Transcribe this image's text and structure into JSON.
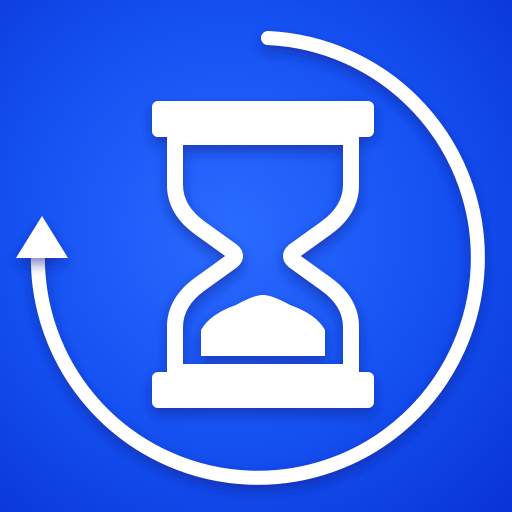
{
  "icon": {
    "name": "hourglass-history-icon",
    "elements": [
      "hourglass-icon",
      "circular-arrow-icon",
      "arrowhead-icon",
      "sand-icon"
    ]
  },
  "colors": {
    "background_center": "#1e5cff",
    "background_edge": "#0a35d6",
    "foreground": "#ffffff",
    "shadow": "#071f8a"
  }
}
